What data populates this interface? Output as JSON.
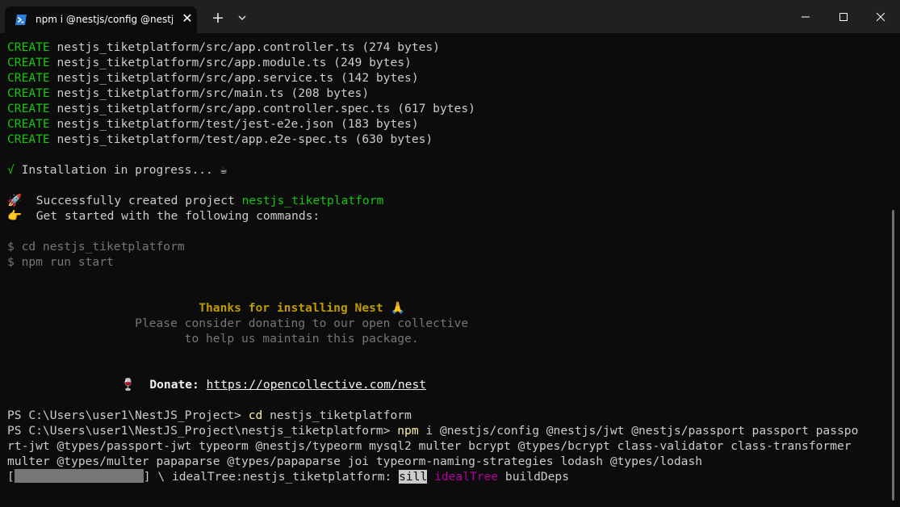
{
  "window": {
    "tab_title": "npm i @nestjs/config @nestjs/jwt",
    "tab_icon": "powershell-icon",
    "close_tab_glyph": "✕",
    "new_tab_glyph": "+"
  },
  "terminal": {
    "create_label": "CREATE",
    "create_lines": [
      "nestjs_tiketplatform/src/app.controller.ts (274 bytes)",
      "nestjs_tiketplatform/src/app.module.ts (249 bytes)",
      "nestjs_tiketplatform/src/app.service.ts (142 bytes)",
      "nestjs_tiketplatform/src/main.ts (208 bytes)",
      "nestjs_tiketplatform/src/app.controller.spec.ts (617 bytes)",
      "nestjs_tiketplatform/test/jest-e2e.json (183 bytes)",
      "nestjs_tiketplatform/test/app.e2e-spec.ts (630 bytes)"
    ],
    "install_check": "√",
    "install_text": "Installation in progress... ☕",
    "success_emoji": "🚀",
    "success_text": "Successfully created project ",
    "project_name": "nestjs_tiketplatform",
    "started_emoji": "👉",
    "started_text": "Get started with the following commands:",
    "cmd_cd": "$ cd nestjs_tiketplatform",
    "cmd_start": "$ npm run start",
    "thanks": "Thanks for installing Nest 🙏",
    "donate_line1": "Please consider donating to our open collective",
    "donate_line2": "to help us maintain this package.",
    "donate_emoji": "🍷",
    "donate_label": "Donate: ",
    "donate_url": "https://opencollective.com/nest",
    "ps_prompt1": "PS C:\\Users\\user1\\NestJS_Project> ",
    "ps_cmd1": "cd",
    "ps_args1": " nestjs_tiketplatform",
    "ps_prompt2": "PS C:\\Users\\user1\\NestJS_Project\\nestjs_tiketplatform> ",
    "ps_cmd2": "npm",
    "ps_args2a": " i @nestjs/config @nestjs/jwt @nestjs/passport passport passpo",
    "ps_args2b": "rt-jwt @types/passport-jwt typeorm @nestjs/typeorm mysql2 multer bcrypt @types/bcrypt class-validator class-transformer",
    "ps_args2c": "multer @types/multer papaparse @types/papaparse joi typeorm-naming-strategies lodash @types/lodash",
    "progress_open": "[",
    "progress_close": "] \\ idealTree:nestjs_tiketplatform: ",
    "progress_level": "sill",
    "progress_stage": "idealTree",
    "progress_task": " buildDeps"
  },
  "colors": {
    "green": "#16c60c",
    "gold": "#c19c00",
    "purple": "#b4009e",
    "yellow": "#f9f1a5"
  }
}
